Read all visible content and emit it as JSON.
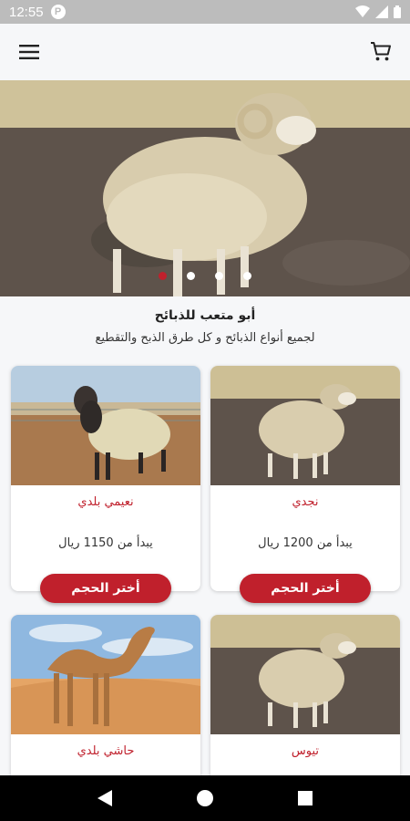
{
  "status_bar": {
    "time": "12:55"
  },
  "banner": {
    "slide_count": 4,
    "active_slide": 0
  },
  "intro": {
    "title": "أبو متعب للذبائح",
    "subtitle": "لجميع أنواع الذبائح و كل طرق الذبح والتقطيع"
  },
  "products": [
    {
      "name": "نجدي",
      "price": "يبدأ من 1200 ريال",
      "button": "أختر الحجم",
      "image": "sheep-najdi"
    },
    {
      "name": "نعيمي بلدي",
      "price": "يبدأ من 1150 ريال",
      "button": "أختر الحجم",
      "image": "sheep-naimi"
    },
    {
      "name": "تيوس",
      "price": "",
      "button": "",
      "image": "goat-tiyous"
    },
    {
      "name": "حاشي بلدي",
      "price": "",
      "button": "",
      "image": "camel-hashi"
    }
  ],
  "colors": {
    "accent": "#c0202c",
    "background": "#f6f7f9"
  }
}
